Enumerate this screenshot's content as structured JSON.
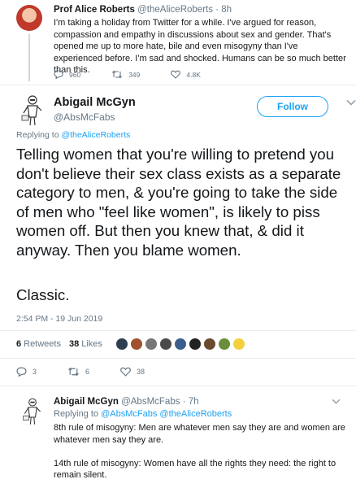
{
  "parent_tweet": {
    "name": "Prof Alice Roberts",
    "handle": "@theAliceRoberts",
    "time": "8h",
    "text": "I'm taking a holiday from Twitter for a while. I've argued for reason, compassion and empathy in discussions about sex and gender. That's opened me up to more hate, bile and even misogyny than I've experienced before. I'm sad and shocked. Humans can be so much better than this.",
    "replies": "960",
    "retweets": "349",
    "likes": "4.8K"
  },
  "main_tweet": {
    "name": "Abigail McGyn",
    "handle": "@AbsMcFabs",
    "follow_label": "Follow",
    "replying_prefix": "Replying to",
    "replying_to": "@theAliceRoberts",
    "text": "Telling women that you're willing to pretend you don't believe their sex class exists as a separate category to men, & you're going to take the side of men who \"feel like women\", is likely to piss women off. But then you knew that, & did it anyway. Then you blame women.",
    "text2": "Classic.",
    "timestamp": "2:54 PM - 19 Jun 2019",
    "retweets_count": "6",
    "retweets_label": "Retweets",
    "likes_count": "38",
    "likes_label": "Likes",
    "replies": "3",
    "retweets": "6",
    "likes": "38"
  },
  "reply_tweet": {
    "name": "Abigail McGyn",
    "handle": "@AbsMcFabs",
    "time": "7h",
    "replying_prefix": "Replying to",
    "replying_to": "@AbsMcFabs @theAliceRoberts",
    "para1": "8th rule of misogyny: Men are whatever men say they are and women are whatever men say they are.",
    "para2": "14th rule of misogyny: Women have all the rights they need: the right to remain silent."
  },
  "colors": {
    "accent": "#1da1f2",
    "muted": "#657786",
    "text": "#14171a",
    "divider": "#e6ecf0"
  }
}
